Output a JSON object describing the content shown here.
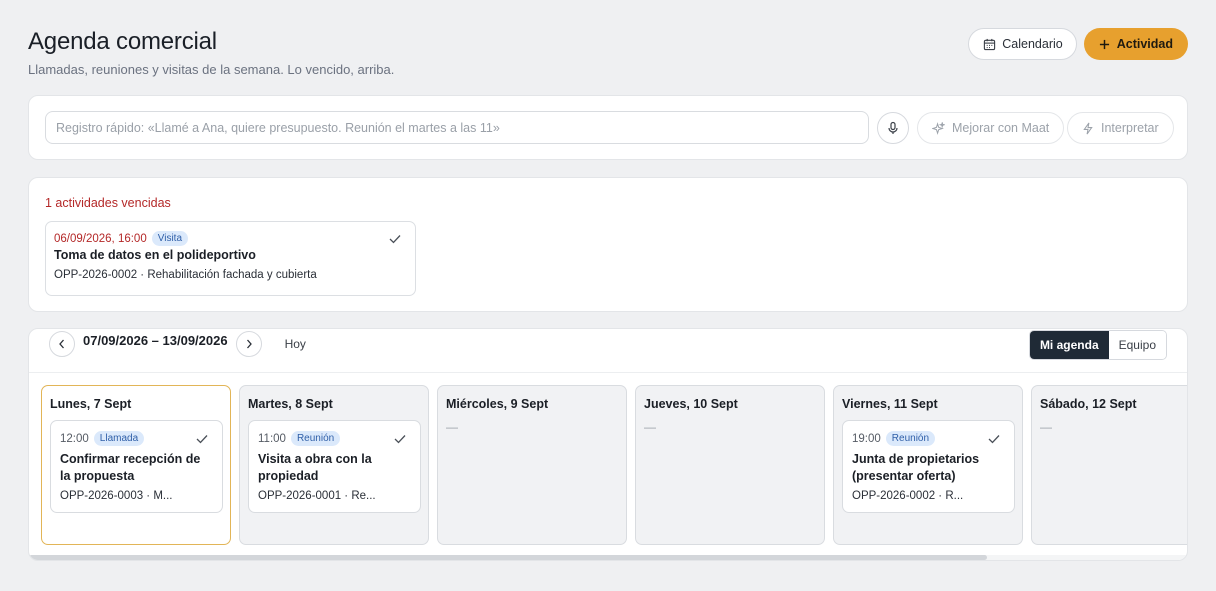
{
  "header": {
    "title": "Agenda comercial",
    "subtitle": "Llamadas, reuniones y visitas de la semana. Lo vencido, arriba.",
    "calendar_label": "Calendario",
    "activity_label": "Actividad"
  },
  "quick_entry": {
    "placeholder": "Registro rápido: «Llamé a Ana, quiere presupuesto. Reunión el martes a las 11»",
    "improve_label": "Mejorar con Maat",
    "interpret_label": "Interpretar"
  },
  "overdue": {
    "title": "1 actividades vencidas",
    "items": [
      {
        "when": "06/09/2026, 16:00",
        "type": "Visita",
        "title": "Toma de datos en el polideportivo",
        "ref": "OPP-2026-0002 · Rehabilitación fachada y cubierta"
      }
    ]
  },
  "week": {
    "range": "07/09/2026 – 13/09/2026",
    "today_label": "Hoy",
    "views": [
      "Mi agenda",
      "Equipo"
    ],
    "active_view": "Mi agenda",
    "empty_marker": "—",
    "days": [
      {
        "label": "Lunes, 7 Sept",
        "is_today": true,
        "event": {
          "time": "12:00",
          "type": "Llamada",
          "title": "Confirmar recepción de la propuesta",
          "ref": "OPP-2026-0003 · M..."
        }
      },
      {
        "label": "Martes, 8 Sept",
        "is_today": false,
        "event": {
          "time": "11:00",
          "type": "Reunión",
          "title": "Visita a obra con la propiedad",
          "ref": "OPP-2026-0001 · Re..."
        }
      },
      {
        "label": "Miércoles, 9 Sept",
        "is_today": false,
        "event": null
      },
      {
        "label": "Jueves, 10 Sept",
        "is_today": false,
        "event": null
      },
      {
        "label": "Viernes, 11 Sept",
        "is_today": false,
        "event": {
          "time": "19:00",
          "type": "Reunión",
          "title": "Junta de propietarios (presentar oferta)",
          "ref": "OPP-2026-0002 · R..."
        }
      },
      {
        "label": "Sábado, 12 Sept",
        "is_today": false,
        "event": null
      }
    ]
  },
  "colors": {
    "accent": "#e7a02e",
    "overdue": "#b42828",
    "badge_bg": "#dbe9fb",
    "badge_text": "#2f5fa8",
    "active_view_bg": "#1f2a36"
  },
  "icons": {
    "calendar": "calendar-icon",
    "plus": "plus-icon",
    "mic": "microphone-icon",
    "sparkle": "sparkle-icon",
    "bolt": "bolt-icon",
    "check": "check-icon",
    "prev": "chevron-left-icon",
    "next": "chevron-right-icon"
  }
}
